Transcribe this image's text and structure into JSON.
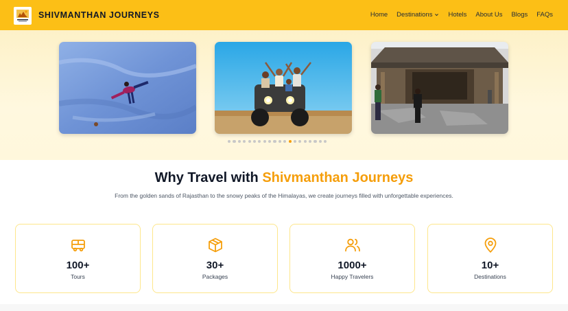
{
  "brand": {
    "name": "SHIVMANTHAN JOURNEYS",
    "logo_icon": "camel-journey-logo"
  },
  "nav": {
    "items": [
      {
        "label": "Home"
      },
      {
        "label": "Destinations",
        "has_dropdown": true
      },
      {
        "label": "Hotels"
      },
      {
        "label": "About Us"
      },
      {
        "label": "Blogs"
      },
      {
        "label": "FAQs"
      }
    ]
  },
  "carousel": {
    "slides": [
      {
        "description_icon": "snow-photo"
      },
      {
        "description_icon": "atv-desert-photo"
      },
      {
        "description_icon": "temple-photo"
      }
    ],
    "dot_count": 20,
    "active_dot": 12
  },
  "why": {
    "title_prefix": "Why Travel with ",
    "title_accent": "Shivmanthan Journeys",
    "subtitle": "From the golden sands of Rajasthan to the snowy peaks of the Himalayas, we create journeys filled with unforgettable experiences.",
    "stats": [
      {
        "value": "100+",
        "label": "Tours",
        "icon": "bus-icon"
      },
      {
        "value": "30+",
        "label": "Packages",
        "icon": "package-icon"
      },
      {
        "value": "1000+",
        "label": "Happy Travelers",
        "icon": "users-icon"
      },
      {
        "value": "10+",
        "label": "Destinations",
        "icon": "map-pin-icon"
      }
    ]
  },
  "colors": {
    "primary": "#fcbf16",
    "accent": "#f59e0b",
    "card_border": "#fde68a"
  }
}
